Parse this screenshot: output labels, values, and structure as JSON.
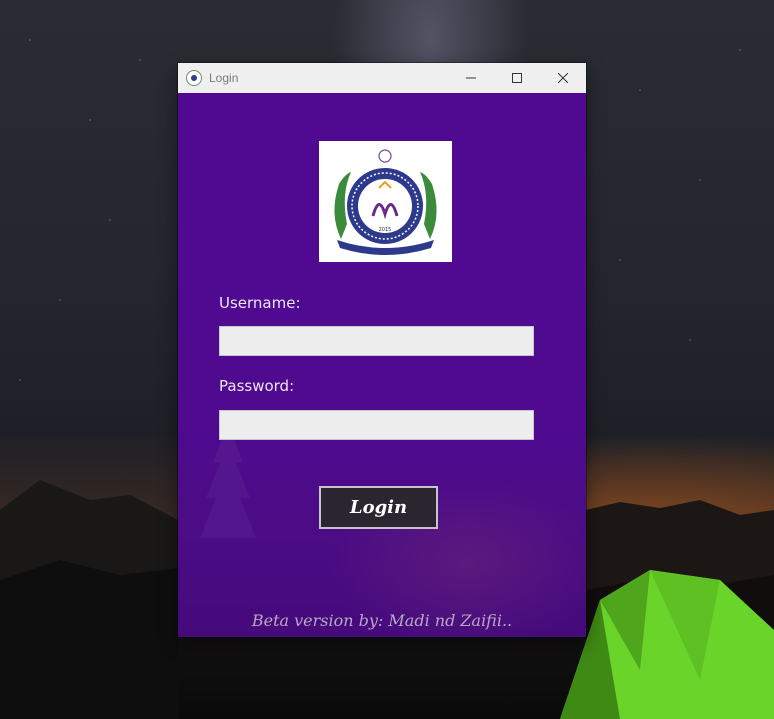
{
  "window": {
    "title": "Login",
    "icon": "university-crest-icon",
    "controls": [
      "minimize-icon",
      "maximize-icon",
      "close-icon"
    ]
  },
  "form": {
    "username_label": "Username:",
    "username_value": "",
    "password_label": "Password:",
    "password_value": "",
    "login_label": "Login"
  },
  "logo": {
    "name": "university-logo",
    "text": "ABBOTTABAD UNIVERSITY OF SCIENCE & TECHNOLOGY",
    "year": "2015"
  },
  "footer": {
    "text": "Beta version by: Madi nd Zaifii.."
  },
  "colors": {
    "window_bg": "#500a92",
    "titlebar_bg": "#f0f0f0",
    "input_bg": "#ededed",
    "button_bg": "#2b2530",
    "footer_text": "#b8a9c4"
  }
}
